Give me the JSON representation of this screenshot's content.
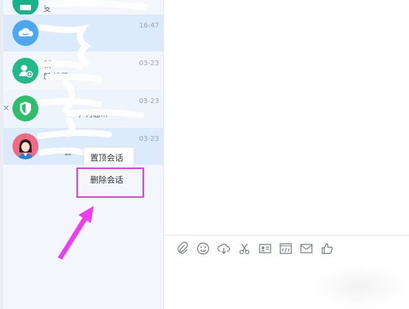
{
  "conversations": [
    {
      "name": "",
      "preview": "支",
      "time": "",
      "selected": false
    },
    {
      "name": "",
      "preview": "",
      "time": "16:47",
      "selected": true
    },
    {
      "name": "新",
      "preview": "新 推荐",
      "time": "03-23",
      "selected": false
    },
    {
      "name": "",
      "preview": "，为您...",
      "time": "03-23",
      "selected": false
    },
    {
      "name": "",
      "preview": "会",
      "time": "03-23",
      "selected": true
    }
  ],
  "context_menu": {
    "items": [
      "置顶会话",
      "删除会话"
    ]
  },
  "close_label": "×",
  "toolbar": {
    "icons": [
      "paperclip-icon",
      "emoji-icon",
      "cloud-download-icon",
      "scissors-icon",
      "contact-card-icon",
      "code-icon",
      "mail-icon",
      "thumbs-up-icon"
    ]
  },
  "colors": {
    "accent": "#2aa7f3",
    "highlight": "#e62fe6",
    "selected_row": "#dcebfb"
  }
}
